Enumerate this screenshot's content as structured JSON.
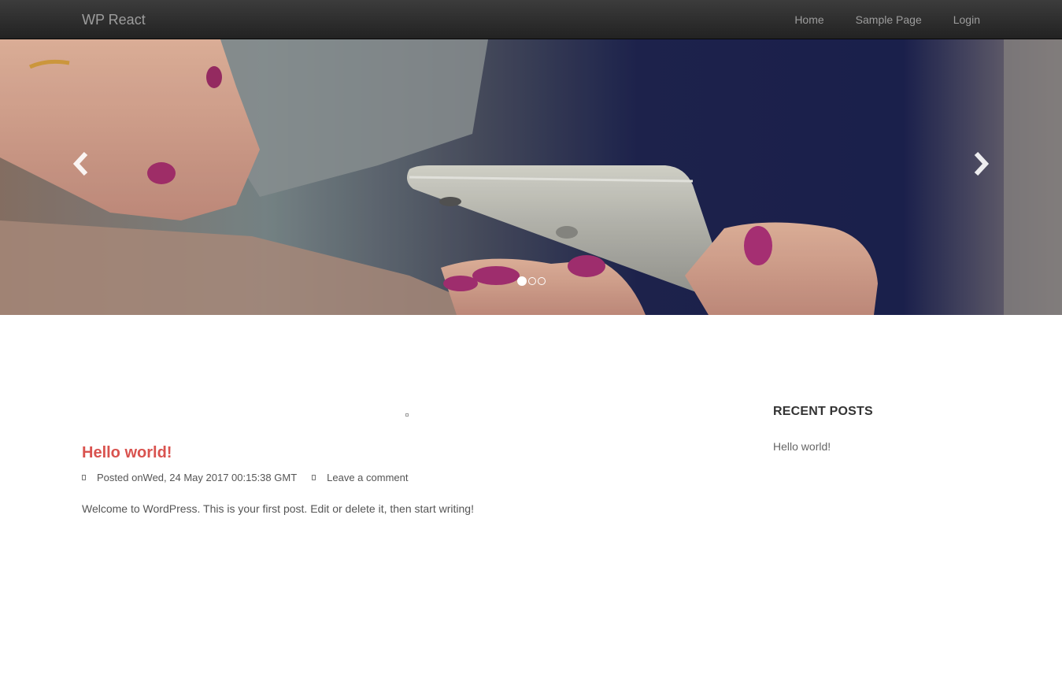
{
  "navbar": {
    "brand": "WP React",
    "links": [
      {
        "label": "Home"
      },
      {
        "label": "Sample Page"
      },
      {
        "label": "Login"
      }
    ]
  },
  "carousel": {
    "slide_count": 3,
    "active_index": 0,
    "image": "woman-holding-smartphone-photo",
    "prev_icon": "chevron-left-icon",
    "next_icon": "chevron-right-icon"
  },
  "post": {
    "title": "Hello world!",
    "posted_on": "Posted onWed, 24 May 2017 00:15:38 GMT",
    "comment_link": "Leave a comment",
    "excerpt": "Welcome to WordPress. This is your first post. Edit or delete it, then start writing!"
  },
  "sidebar": {
    "widget_title": "RECENT POSTS",
    "recent_posts": [
      "Hello world!"
    ]
  },
  "colors": {
    "navbar_bg": "#222222",
    "nav_text": "#9d9d9d",
    "post_title": "#d9534f",
    "body_text": "#555555"
  }
}
